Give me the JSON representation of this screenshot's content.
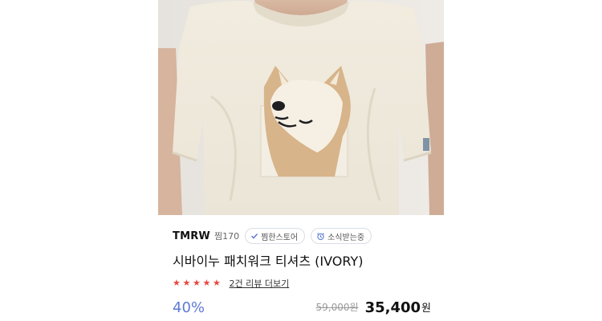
{
  "product": {
    "brand": "TMRW",
    "like_count": "찜170",
    "tags": [
      {
        "label": "찜한스토어",
        "icon": "check-icon"
      },
      {
        "label": "소식받는중",
        "icon": "alarm-clock-icon"
      }
    ],
    "title": "시바이누 패치워크 티셔츠 (IVORY)",
    "rating": {
      "stars": 5,
      "max": 5,
      "star_color": "#e8473f",
      "review_text": "2건 리뷰 더보기"
    },
    "price": {
      "discount": "40%",
      "original": "59,000원",
      "sale": "35,400",
      "currency": "원"
    }
  },
  "colors": {
    "discount": "#5e7bd6",
    "star": "#e8473f",
    "tshirt": "#efe9dc"
  }
}
